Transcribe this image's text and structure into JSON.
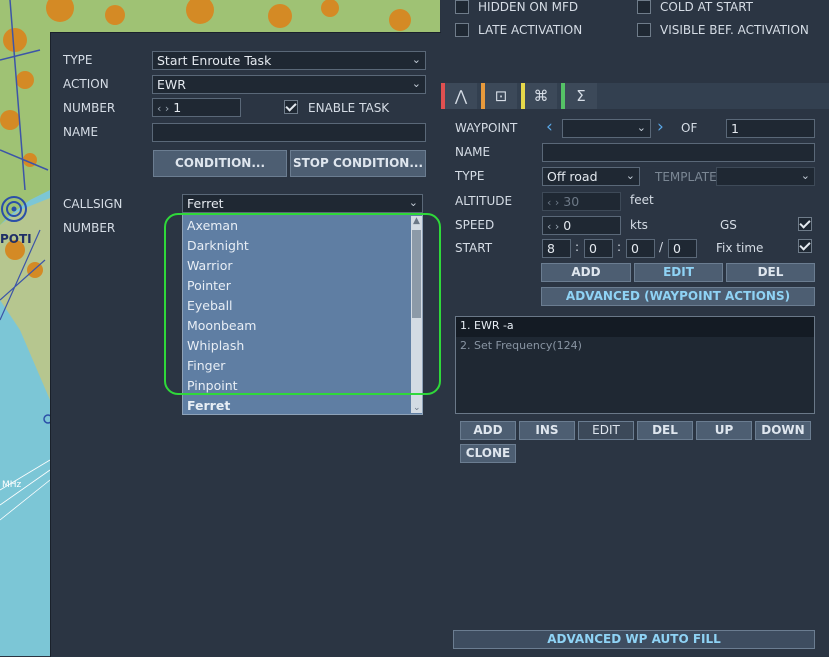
{
  "map": {
    "label_city": "POTI",
    "label_mhz": "MHz"
  },
  "flags": {
    "hidden_on_mfd": "HIDDEN ON MFD",
    "cold_at_start": "COLD AT START",
    "late_activation": "LATE ACTIVATION",
    "visible_bef_activation": "VISIBLE BEF. ACTIVATION"
  },
  "task": {
    "type_label": "TYPE",
    "type_value": "Start Enroute Task",
    "action_label": "ACTION",
    "action_value": "EWR",
    "number_label": "NUMBER",
    "number_value": "1",
    "enable_task_label": "ENABLE TASK",
    "name_label": "NAME",
    "name_value": "",
    "condition_button": "CONDITION...",
    "stop_condition_button": "STOP CONDITION...",
    "callsign_label": "CALLSIGN",
    "callsign_value": "Ferret",
    "number2_label": "NUMBER",
    "callsign_options": [
      "Axeman",
      "Darknight",
      "Warrior",
      "Pointer",
      "Eyeball",
      "Moonbeam",
      "Whiplash",
      "Finger",
      "Pinpoint",
      "Ferret"
    ]
  },
  "waypoint": {
    "tabs": [
      "route-icon",
      "target-icon",
      "nav-icon",
      "sum-icon"
    ],
    "tab_colors": [
      "#e05050",
      "#e89a3c",
      "#e6d84a",
      "#55c266"
    ],
    "waypoint_label": "WAYPOINT",
    "of_label": "OF",
    "of_value": "1",
    "name_label": "NAME",
    "type_label": "TYPE",
    "type_value": "Off road",
    "template_label": "TEMPLATE",
    "altitude_label": "ALTITUDE",
    "altitude_value": "30",
    "altitude_unit": "feet",
    "speed_label": "SPEED",
    "speed_value": "0",
    "speed_unit": "kts",
    "gs_label": "GS",
    "start_label": "START",
    "start_day": "8",
    "start_h": "0",
    "start_m": "0",
    "start_s": "0",
    "fix_time_label": "Fix time",
    "add": "ADD",
    "edit": "EDIT",
    "del": "DEL",
    "advanced_actions": "ADVANCED (WAYPOINT ACTIONS)",
    "actions": [
      "1. EWR -a",
      "2. Set Frequency(124)"
    ],
    "list_buttons": [
      "ADD",
      "INS",
      "EDIT",
      "DEL",
      "UP",
      "DOWN",
      "CLONE"
    ],
    "auto_fill": "ADVANCED WP AUTO FILL"
  }
}
